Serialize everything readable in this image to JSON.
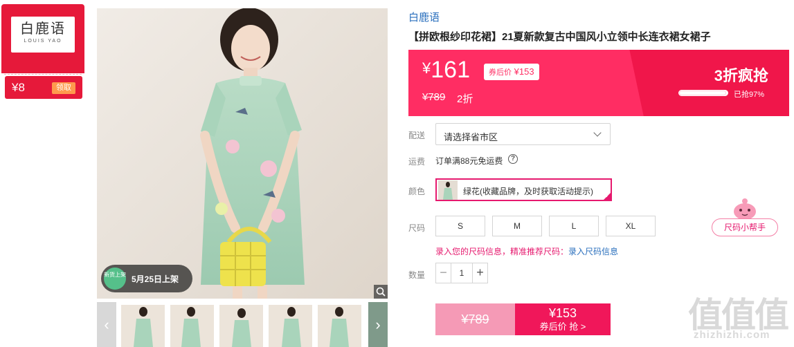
{
  "shop": {
    "logo_cn": "白鹿语",
    "logo_en": "LOUIS YAO",
    "coupon_amount": "¥8",
    "coupon_action": "领取",
    "colors": {
      "red": "#e6193a",
      "orange": "#ff9a4d"
    }
  },
  "gallery": {
    "new_badge_icon_text": "新货上架",
    "new_badge_text": "5月25日上架",
    "thumbnail_count": 5
  },
  "product": {
    "brand": "白鹿语",
    "title": "【拼欧根纱印花裙】21夏新款复古中国风小立领中长连衣裙女裙子"
  },
  "price": {
    "currency": "¥",
    "current": "161",
    "coupon_label": "券后价",
    "coupon_price": "¥153",
    "original": "¥789",
    "discount": "2折",
    "flash_title": "3折疯抢",
    "sold_label": "已抢97%",
    "sold_fraction": 0.97,
    "colors": {
      "band": "#ff2d63",
      "band_dark": "#f0164a"
    }
  },
  "options": {
    "delivery_label": "配送",
    "delivery_placeholder": "请选择省市区",
    "shipping_label": "运费",
    "shipping_text": "订单满88元免运费",
    "help_glyph": "?",
    "color_label": "颜色",
    "color_selected": "绿花(收藏品牌，及时获取活动提示)",
    "size_label": "尺码",
    "sizes": [
      "S",
      "M",
      "L",
      "XL"
    ],
    "size_tip": "录入您的尺码信息，精准推荐尺码：",
    "size_tip_link": "录入尺码信息",
    "qty_label": "数量",
    "qty_minus": "−",
    "qty_value": "1",
    "qty_plus": "+"
  },
  "buy": {
    "original_price": "¥789",
    "coupon_price": "¥153",
    "coupon_label": "券后价 抢 >"
  },
  "helper": {
    "label": "尺码小帮手"
  },
  "watermark": {
    "cn": "值值值",
    "en": "zhizhizhi.com"
  }
}
